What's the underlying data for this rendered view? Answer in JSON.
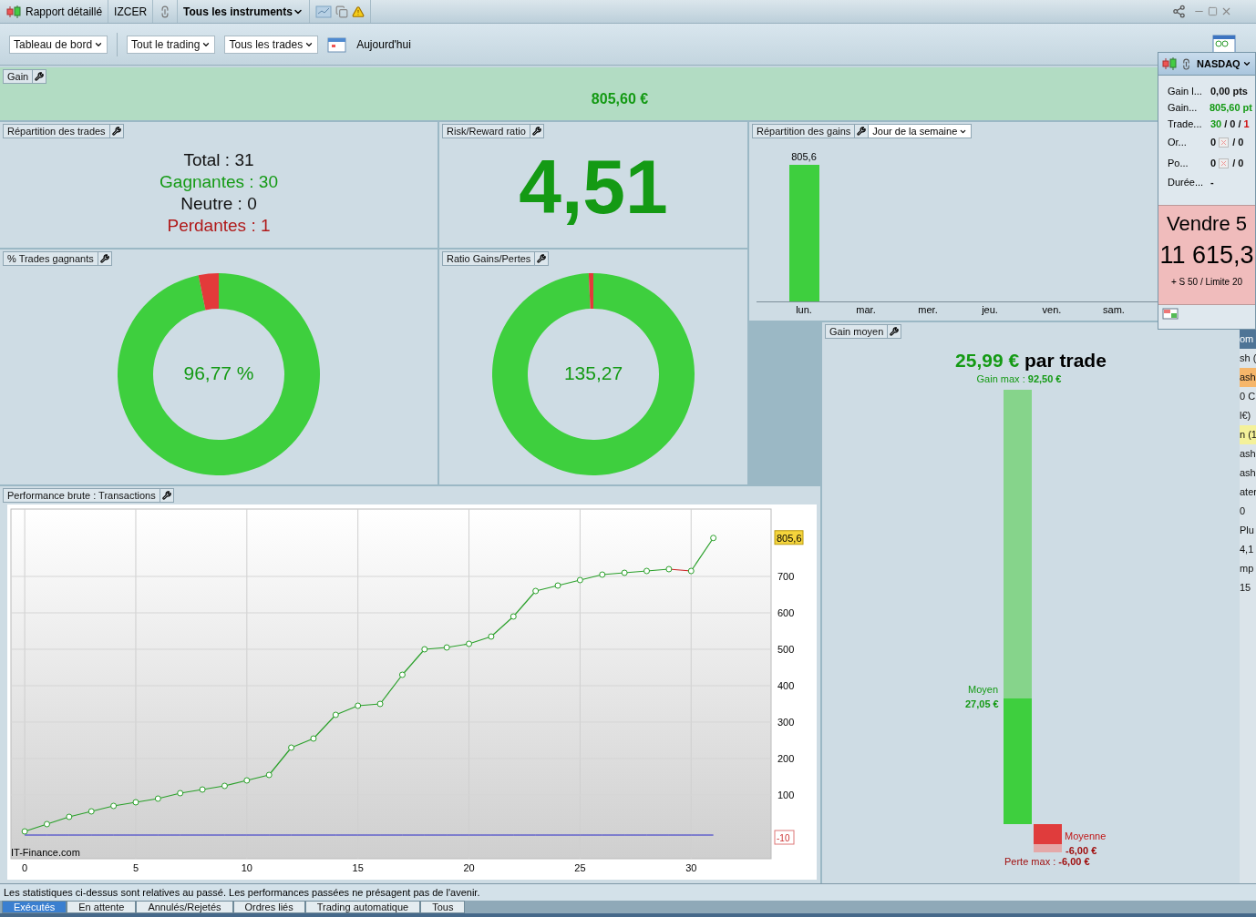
{
  "title_bar": {
    "title": "Rapport détaillé",
    "account": "IZCER",
    "instrument": "Tous les instruments"
  },
  "toolbar": {
    "dropdowns": [
      {
        "label": "Tableau de bord"
      },
      {
        "label": "Tout le trading"
      },
      {
        "label": "Tous les trades"
      }
    ],
    "date": "Aujourd'hui"
  },
  "gain_panel": {
    "label": "Gain",
    "value": "805,60 €"
  },
  "trades_panel": {
    "label": "Répartition des trades",
    "lines": [
      {
        "kind": "total",
        "text": "Total : 31"
      },
      {
        "kind": "win",
        "text": "Gagnantes : 30"
      },
      {
        "kind": "neutral",
        "text": "Neutre : 0"
      },
      {
        "kind": "loss",
        "text": "Perdantes : 1"
      }
    ]
  },
  "rr_panel": {
    "label": "Risk/Reward ratio",
    "value": "4,51"
  },
  "gains_panel": {
    "label": "Répartition des gains",
    "period": "Jour de la semaine",
    "chart_data": {
      "type": "bar",
      "categories": [
        "lun.",
        "mar.",
        "mer.",
        "jeu.",
        "ven.",
        "sam."
      ],
      "values": [
        805.6,
        0,
        0,
        0,
        0,
        0
      ],
      "value_labels": [
        "805,6",
        null,
        null,
        null,
        null,
        null
      ]
    }
  },
  "win_pct_panel": {
    "label": "% Trades gagnants",
    "center": "96,77 %",
    "chart_data": {
      "type": "donut",
      "values": [
        96.77,
        3.23
      ]
    }
  },
  "ratio_panel": {
    "label": "Ratio Gains/Pertes",
    "center": "135,27",
    "chart_data": {
      "type": "donut",
      "values": [
        99.26,
        0.74
      ]
    }
  },
  "perf_panel": {
    "label": "Performance brute : Transactions",
    "credit": "IT-Finance.com",
    "last_tag": "805,6",
    "zero_tag": "-10",
    "chart_data": {
      "type": "line",
      "x": [
        0,
        1,
        2,
        3,
        4,
        5,
        6,
        7,
        8,
        9,
        10,
        11,
        12,
        13,
        14,
        15,
        16,
        17,
        18,
        19,
        20,
        21,
        22,
        23,
        24,
        25,
        26,
        27,
        28,
        29,
        30,
        31
      ],
      "series": [
        {
          "color": "#2aa02a",
          "marker": "o",
          "values": [
            0,
            20,
            40,
            55,
            70,
            80,
            90,
            105,
            115,
            125,
            140,
            155,
            230,
            255,
            320,
            345,
            350,
            430,
            500,
            505,
            515,
            535,
            590,
            660,
            675,
            690,
            705,
            710,
            715,
            720,
            715,
            805.6
          ]
        },
        {
          "color": "#2b2bc8",
          "values": [
            -10,
            -10,
            -10,
            -10,
            -10,
            -10,
            -10,
            -10,
            -10,
            -10,
            -10,
            -10,
            -10,
            -10,
            -10,
            -10,
            -10,
            -10,
            -10,
            -10,
            -10,
            -10,
            -10,
            -10,
            -10,
            -10,
            -10,
            -10,
            -10,
            -10,
            -10,
            -10
          ]
        }
      ],
      "grid": true,
      "xlim": [
        -0.62,
        33.6
      ],
      "ylim": [
        -75,
        885
      ],
      "xticks": [
        0,
        5,
        10,
        15,
        20,
        25,
        30
      ],
      "yticks": [
        100,
        200,
        300,
        400,
        500,
        600,
        700
      ]
    }
  },
  "avg_panel": {
    "label": "Gain moyen",
    "value": "25,99 €",
    "suffix": "par trade",
    "max_text": "Gain max : **92,50 €**",
    "avg_label": "Moyen",
    "avg_value": "27,05 €",
    "level": 0.29,
    "loss_label": "Moyenne",
    "loss_value": "-6,00 €",
    "loss_max_text": "Perte max : **-6,00 €**"
  },
  "quick_panel": {
    "instrument": "NASDAQ",
    "rows": [
      {
        "kind": "text",
        "label": "Gain l...",
        "value": "0,00 pts"
      },
      {
        "kind": "gain",
        "label": "Gain...",
        "value": "805,60 pt"
      },
      {
        "kind": "trades",
        "label": "Trade...",
        "parts": [
          {
            "kind": "win",
            "text": "30"
          },
          {
            "kind": "plain",
            "text": "/ 0 /"
          },
          {
            "kind": "loss",
            "text": "1"
          }
        ]
      },
      {
        "kind": "orders",
        "label": "Or...",
        "count": "0",
        "total": "/ 0"
      },
      {
        "kind": "orders",
        "label": "Po...",
        "count": "0",
        "total": "/ 0"
      },
      {
        "kind": "text",
        "label": "Durée...",
        "value": "-"
      }
    ],
    "order": {
      "side": "Vendre 5",
      "price": "11 615,3",
      "details": "+ S 50 / Limite 20"
    }
  },
  "background_window": {
    "fragments": [
      {
        "text": "om",
        "color": "#4f7496"
      },
      {
        "text": "sh ("
      },
      {
        "text": "ash",
        "color": "#f6b66a"
      },
      {
        "text": "0 C"
      },
      {
        "text": "l€)"
      },
      {
        "text": "n (1",
        "color": "#f4f19a"
      },
      {
        "text": "ash"
      },
      {
        "text": "ash"
      },
      {
        "text": "ater"
      },
      {
        "text": "0"
      },
      {
        "text": "Plu"
      },
      {
        "text": "4,1"
      },
      {
        "text": "mp"
      },
      {
        "text": "15"
      }
    ]
  },
  "disclaimer": "Les statistiques ci-dessus sont relatives au passé. Les performances passées ne présagent pas de l'avenir.",
  "bottom_tabs": [
    {
      "label": "Exécutés",
      "selected": true
    },
    {
      "label": "En attente",
      "selected": false
    },
    {
      "label": "Annulés/Rejetés",
      "selected": false
    },
    {
      "label": "Ordres liés",
      "selected": false
    },
    {
      "label": "Trading automatique",
      "selected": false
    },
    {
      "label": "Tous",
      "selected": false
    }
  ]
}
